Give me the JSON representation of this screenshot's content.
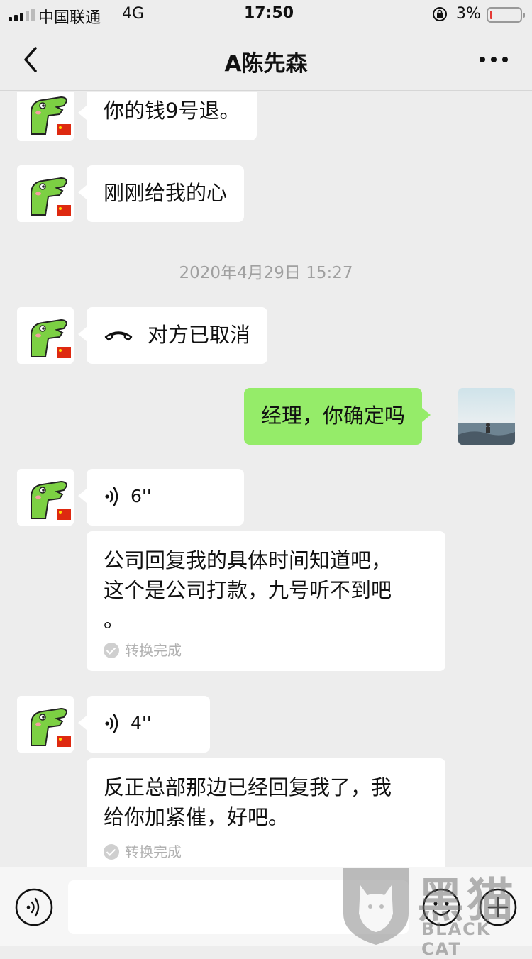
{
  "status_bar": {
    "carrier": "中国联通",
    "network": "4G",
    "time": "17:50",
    "battery": "3%"
  },
  "nav": {
    "title": "A陈先森"
  },
  "messages": [
    {
      "side": "left",
      "type": "text",
      "text": "你的钱9号退。"
    },
    {
      "side": "left",
      "type": "text",
      "text": "刚刚给我的心"
    },
    {
      "type": "time",
      "text": "2020年4月29日 15:27"
    },
    {
      "side": "left",
      "type": "call",
      "text": "对方已取消"
    },
    {
      "side": "right",
      "type": "text",
      "text": "经理，你确定吗"
    },
    {
      "side": "left",
      "type": "voice",
      "duration": "6''",
      "transcript_lines": [
        "公司回复我的具体时间知道吧，",
        "这个是公司打款，九号听不到吧",
        "。"
      ],
      "status": "转换完成"
    },
    {
      "side": "left",
      "type": "voice",
      "duration": "4''",
      "transcript_lines": [
        "反正总部那边已经回复我了，我",
        "给你加紧催，好吧。"
      ],
      "status": "转换完成"
    }
  ],
  "input": {
    "placeholder": ""
  },
  "watermark": {
    "cn": "黑猫",
    "en": "BLACK CAT"
  },
  "colors": {
    "background": "#ededed",
    "bubble_in": "#ffffff",
    "bubble_out": "#95ec69",
    "battery_low": "#e53935"
  }
}
